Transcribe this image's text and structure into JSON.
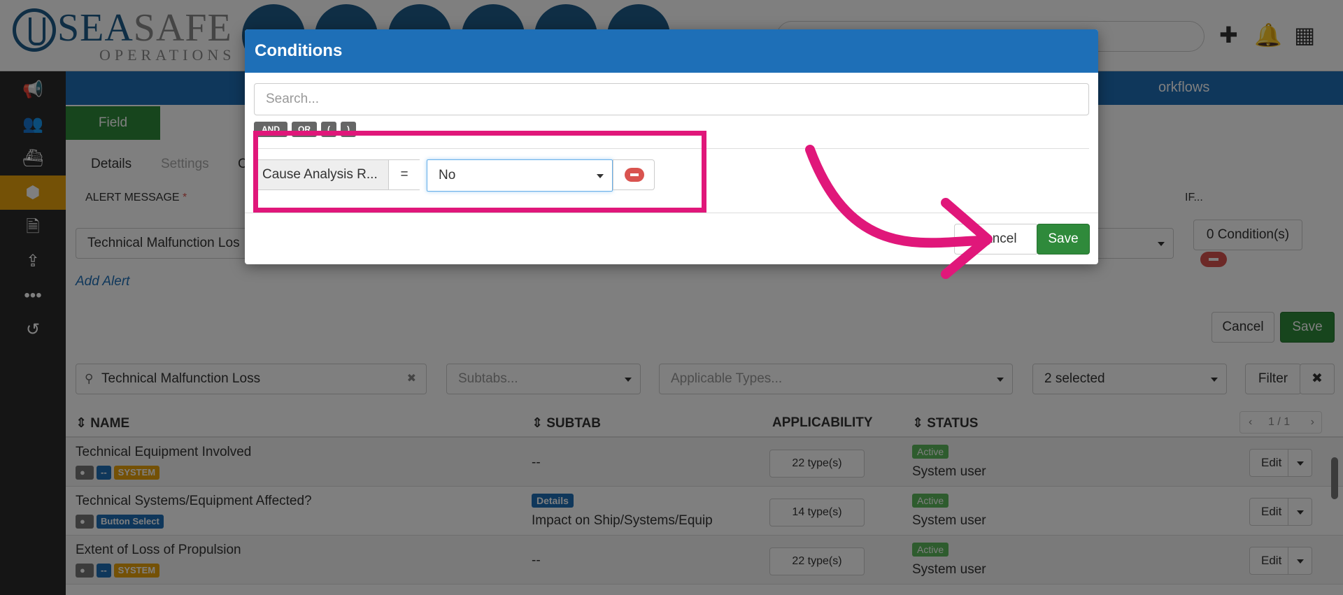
{
  "logo": {
    "word_primary": "SEA",
    "word_secondary": "SAFE",
    "subtitle": "OPERATIONS"
  },
  "topbar": {
    "plus_icon": "plus-icon",
    "bell_icon": "bell-icon",
    "grid_icon": "grid-icon"
  },
  "sidebar": {
    "items": [
      "megaphone-icon",
      "users-icon",
      "ship-icon",
      "cubes-icon",
      "document-icon",
      "upload-icon",
      "more-icon",
      "history-icon"
    ],
    "active_index": 3
  },
  "bluebar": {
    "workflows": "orkflows"
  },
  "field_tab": "Field",
  "subtabs": {
    "details": "Details",
    "settings": "Settings",
    "c": "C"
  },
  "alert": {
    "label": "ALERT MESSAGE",
    "required": "*",
    "value": "Technical Malfunction Los",
    "if_label": "IF...",
    "conditions_btn": "0 Condition(s)",
    "add_alert": "Add Alert",
    "cancel": "Cancel",
    "save": "Save"
  },
  "filters": {
    "search_value": "Technical Malfunction Loss",
    "subtabs_placeholder": "Subtabs...",
    "types_placeholder": "Applicable Types...",
    "selected": "2 selected",
    "filter_btn": "Filter",
    "clear_icon": "✖"
  },
  "table": {
    "headers": {
      "name": "NAME",
      "subtab": "SUBTAB",
      "applicability": "APPLICABILITY",
      "status": "STATUS"
    },
    "pager": "1 / 1",
    "rows": [
      {
        "name": "Technical Equipment Involved",
        "tags": [
          "--",
          "SYSTEM"
        ],
        "subtab": "--",
        "subtab_tag": "",
        "types": "22 type(s)",
        "status": "Active",
        "user": "System user",
        "edit": "Edit"
      },
      {
        "name": "Technical Systems/Equipment Affected?",
        "tags": [
          "Button Select"
        ],
        "subtab": "Impact on Ship/Systems/Equip",
        "subtab_tag": "Details",
        "types": "14 type(s)",
        "status": "Active",
        "user": "System user",
        "edit": "Edit"
      },
      {
        "name": "Extent of Loss of Propulsion",
        "tags": [
          "--",
          "SYSTEM"
        ],
        "subtab": "--",
        "subtab_tag": "",
        "types": "22 type(s)",
        "status": "Active",
        "user": "System user",
        "edit": "Edit"
      }
    ]
  },
  "modal": {
    "title": "Conditions",
    "search_placeholder": "Search...",
    "operators": [
      "AND",
      "OR",
      "(",
      ")"
    ],
    "condition": {
      "field": "Cause Analysis R...",
      "operator": "=",
      "value": "No"
    },
    "cancel": "Cancel",
    "save": "Save"
  },
  "colors": {
    "brand_blue": "#1e6fb7",
    "save_green": "#2f8a3b",
    "sidebar_active": "#e8a20c",
    "highlight": "#e0177a",
    "danger": "#d9534f"
  }
}
